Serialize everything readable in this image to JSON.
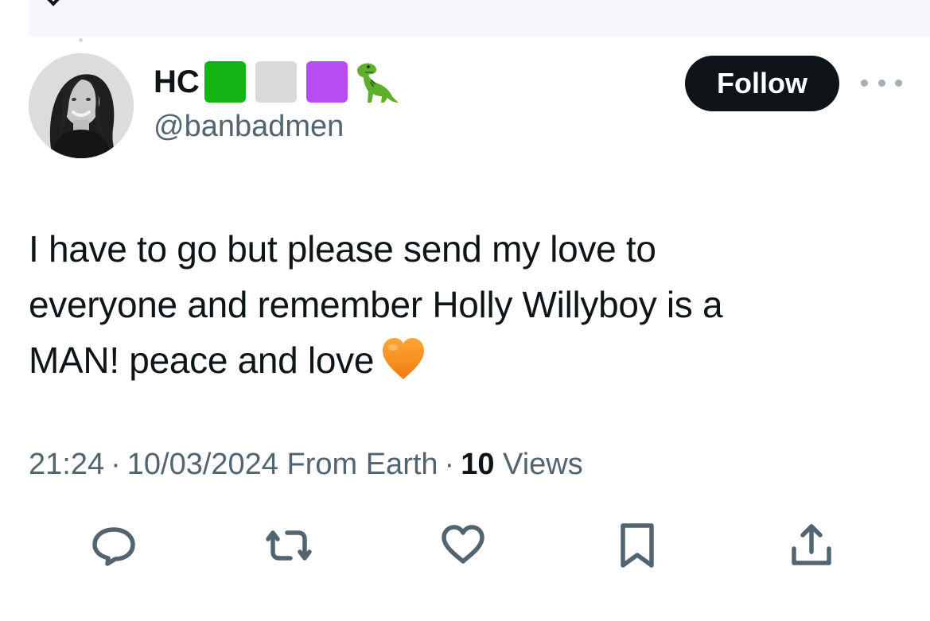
{
  "tweet": {
    "author": {
      "display_name": "HC",
      "flag_colors": [
        "#12b312",
        "#d9d9d9",
        "#b74cf2"
      ],
      "emoji_icon": "t-rex-icon",
      "handle": "@banbadmen"
    },
    "follow_label": "Follow",
    "text_lines": [
      "I have to go but please send my love to",
      "everyone and remember Holly Willyboy is a",
      "MAN! peace and love"
    ],
    "text_emoji_icon": "orange-heart-icon",
    "meta": {
      "time": "21:24",
      "separator": "·",
      "date": "10/03/2024",
      "source": "From Earth",
      "views_count": "10",
      "views_label": "Views"
    },
    "actions": [
      "reply-icon",
      "retweet-icon",
      "like-icon",
      "bookmark-icon",
      "share-icon"
    ]
  },
  "colors": {
    "text_primary": "#0f1419",
    "text_secondary": "#536471",
    "follow_bg": "#0f1419",
    "heart": "#f58a1f"
  }
}
